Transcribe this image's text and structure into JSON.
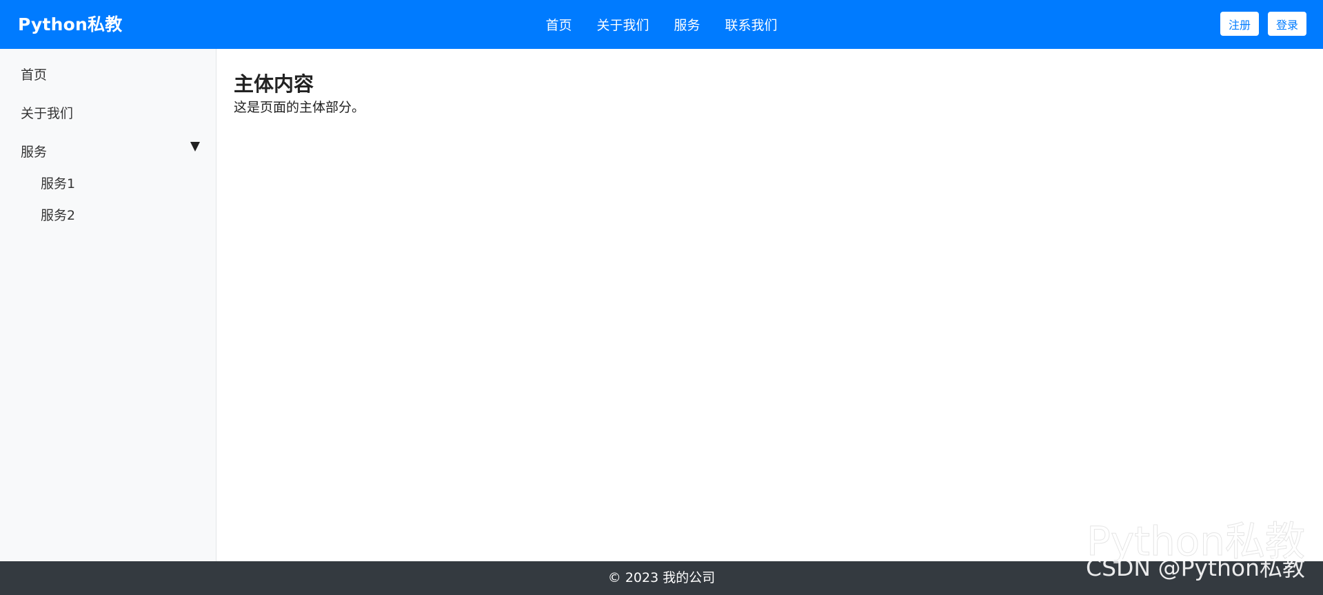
{
  "navbar": {
    "brand": "Python私教",
    "links": [
      "首页",
      "关于我们",
      "服务",
      "联系我们"
    ],
    "register_label": "注册",
    "login_label": "登录",
    "color": "#007bff"
  },
  "sidebar": {
    "items": [
      "首页",
      "关于我们",
      "服务"
    ],
    "services_submenu": [
      "服务1",
      "服务2"
    ],
    "expand_icon": "caret-down-icon"
  },
  "main": {
    "title": "主体内容",
    "text": "这是页面的主体部分。"
  },
  "footer": {
    "text": "© 2023 我的公司",
    "color": "#343a40"
  },
  "watermark": {
    "line1": "Python私教",
    "line2": "CSDN @Python私教"
  }
}
